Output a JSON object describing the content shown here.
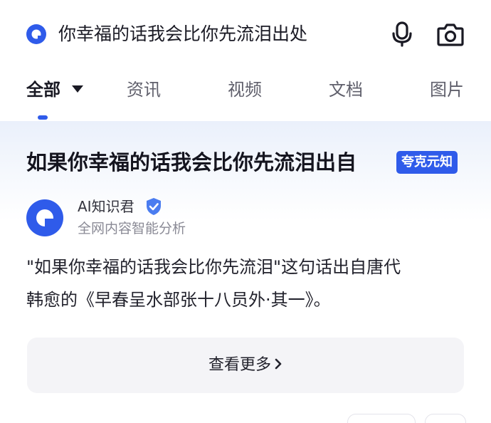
{
  "search": {
    "query": "你幸福的话我会比你先流泪出处",
    "logo_icon": "search-engine-logo",
    "mic_icon": "microphone-icon",
    "camera_icon": "camera-icon"
  },
  "tabs": [
    {
      "label": "全部",
      "active": true
    },
    {
      "label": "资讯",
      "active": false
    },
    {
      "label": "视频",
      "active": false
    },
    {
      "label": "文档",
      "active": false
    },
    {
      "label": "图片",
      "active": false
    }
  ],
  "answer": {
    "title": "如果你幸福的话我会比你先流泪出自",
    "badge": "夸克元知",
    "author": {
      "name": "AI知识君",
      "description": "全网内容智能分析",
      "verified": true
    },
    "text_lines": [
      "\"如果你幸福的话我会比你先流泪\"这句话出自唐代",
      "韩愈的《早春呈水部张十八员外·其一》。"
    ],
    "more_label": "查看更多"
  },
  "colors": {
    "accent": "#2f5bea",
    "title": "#15151f",
    "secondary_text": "#8a8a95",
    "more_button_bg": "#f4f4f7"
  }
}
